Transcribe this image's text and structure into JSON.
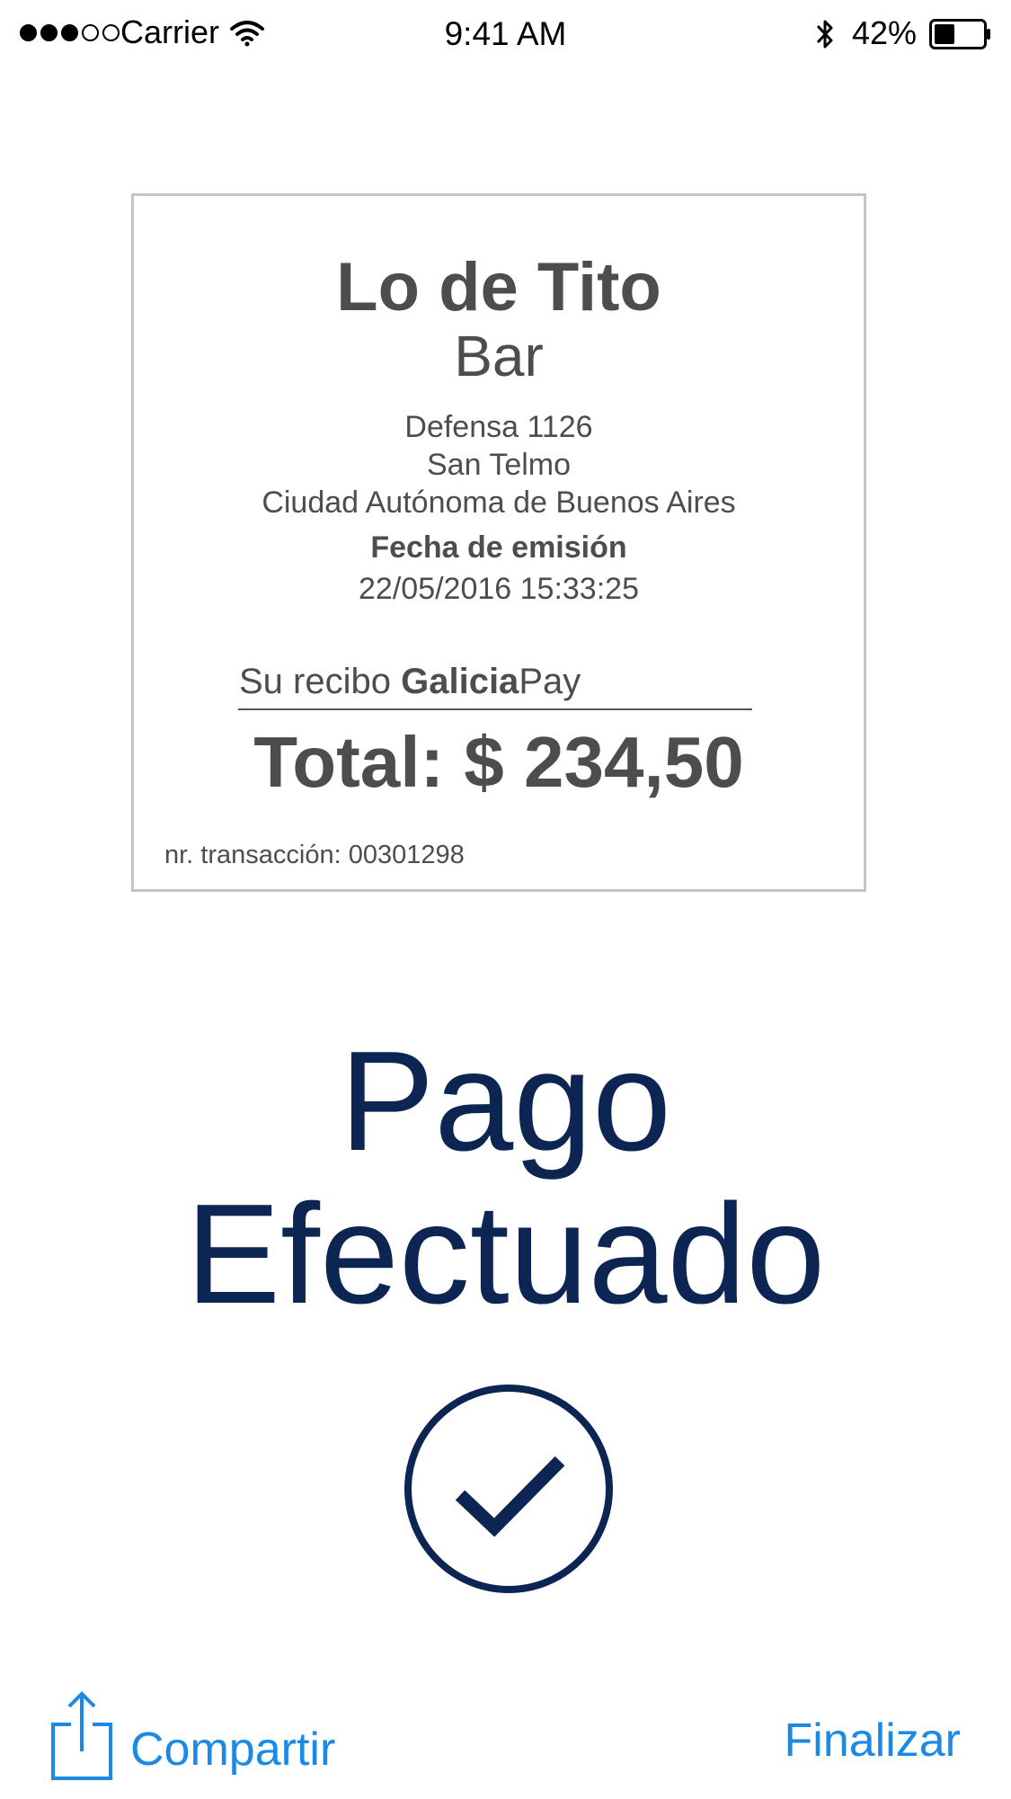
{
  "status_bar": {
    "signal_bars_filled": 3,
    "signal_bars_total": 5,
    "carrier": "Carrier",
    "time": "9:41 AM",
    "battery_percent": "42%",
    "battery_level": 0.42,
    "icons": [
      "wifi-icon",
      "bluetooth-icon",
      "battery-icon"
    ]
  },
  "receipt": {
    "merchant_name": "Lo de Tito",
    "merchant_type": "Bar",
    "address_line1": "Defensa 1126",
    "address_line2": "San Telmo",
    "address_line3": "Ciudad Autónoma de Buenos Aires",
    "date_label": "Fecha de emisión",
    "date_value": "22/05/2016 15:33:25",
    "heading_prefix": "Su recibo ",
    "heading_brand_bold": "Galicia",
    "heading_brand_regular": "Pay",
    "total": "Total: $ 234,50",
    "transaction": "nr. transacción: 00301298"
  },
  "result": {
    "title_line1": "Pago",
    "title_line2": "Efectuado",
    "icon": "checkmark-circle-icon"
  },
  "actions": {
    "share_label": "Compartir",
    "share_icon": "share-icon",
    "finish_label": "Finalizar"
  },
  "colors": {
    "accent": "#1a8ae6",
    "success": "#0d2553",
    "receipt_text": "#4d4d4d",
    "receipt_border": "#c4c4c4"
  }
}
